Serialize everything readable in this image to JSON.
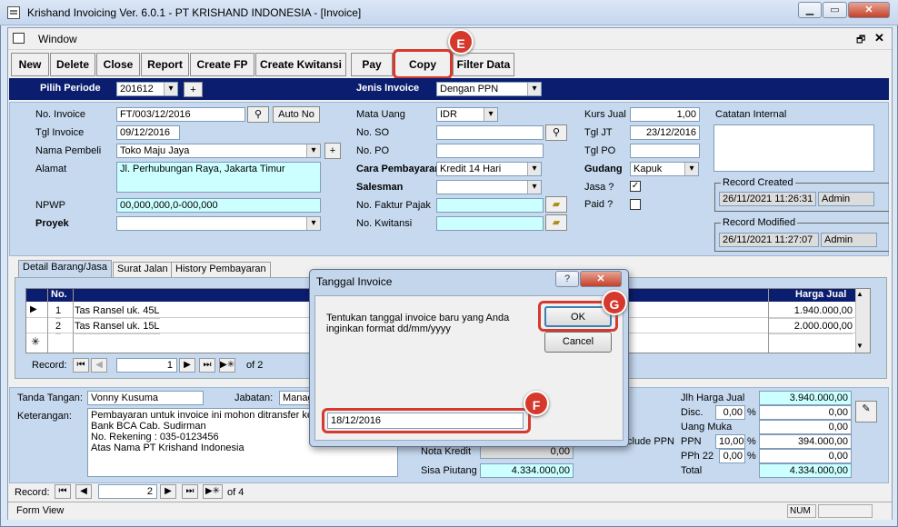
{
  "window": {
    "title": "Krishand Invoicing Ver. 6.0.1 - PT KRISHAND INDONESIA - [Invoice]"
  },
  "menu": {
    "window_label": "Window",
    "restore": "🗗",
    "close": "✕"
  },
  "toolbar": {
    "buttons": [
      "New",
      "Delete",
      "Close",
      "Report",
      "Create FP",
      "Create Kwitansi",
      "Pay",
      "Copy",
      "Filter Data"
    ]
  },
  "badges": {
    "e": "E",
    "f": "F",
    "g": "G"
  },
  "period": {
    "label": "Pilih Periode",
    "value": "201612",
    "plus": "+",
    "jenis_label": "Jenis Invoice",
    "jenis_value": "Dengan PPN"
  },
  "header": {
    "no_invoice_label": "No. Invoice",
    "no_invoice": "FT/003/12/2016",
    "auto_no": "Auto No",
    "tgl_invoice_label": "Tgl Invoice",
    "tgl_invoice": "09/12/2016",
    "nama_pembeli_label": "Nama Pembeli",
    "nama_pembeli": "Toko Maju Jaya",
    "alamat_label": "Alamat",
    "alamat": "Jl. Perhubungan Raya, Jakarta Timur",
    "npwp_label": "NPWP",
    "npwp": "00,000,000,0-000,000",
    "proyek_label": "Proyek",
    "mata_uang_label": "Mata Uang",
    "mata_uang": "IDR",
    "no_so_label": "No. SO",
    "no_po_label": "No. PO",
    "cara_bayar_label": "Cara Pembayaran",
    "cara_bayar": "Kredit 14 Hari",
    "salesman_label": "Salesman",
    "faktur_label": "No. Faktur Pajak",
    "kwitansi_label": "No. Kwitansi",
    "kurs_label": "Kurs Jual",
    "kurs": "1,00",
    "tgl_jt_label": "Tgl JT",
    "tgl_jt": "23/12/2016",
    "tgl_po_label": "Tgl PO",
    "gudang_label": "Gudang",
    "gudang": "Kapuk",
    "jasa_label": "Jasa ?",
    "paid_label": "Paid ?",
    "catatan_label": "Catatan Internal",
    "created_label": "Record Created",
    "created_date": "26/11/2021 11:26:31",
    "created_by": "Admin",
    "modified_label": "Record Modified",
    "modified_date": "26/11/2021 11:27:07",
    "modified_by": "Admin"
  },
  "tabs": [
    "Detail Barang/Jasa",
    "Surat Jalan",
    "History Pembayaran"
  ],
  "grid": {
    "col_no": "No.",
    "col_harga": "Harga Jual",
    "rows": [
      {
        "no": "1",
        "item": "Tas Ransel uk. 45L",
        "harga": "1.940.000,00"
      },
      {
        "no": "2",
        "item": "Tas Ransel uk. 15L",
        "harga": "2.000.000,00"
      }
    ],
    "record_label": "Record:",
    "record_value": "1",
    "record_of": "of  2"
  },
  "footer": {
    "tanda_tangan_label": "Tanda Tangan:",
    "tanda_tangan": "Vonny Kusuma",
    "jabatan_label": "Jabatan:",
    "jabatan": "Manag",
    "keterangan_label": "Keterangan:",
    "keterangan": [
      "Pembayaran untuk invoice ini mohon ditransfer ke r",
      "Bank BCA Cab. Sudirman",
      "No. Rekening : 035-0123456",
      "Atas Nama PT Krishand Indonesia"
    ],
    "nota_kredit_label": "Nota Kredit",
    "nota_kredit": "0,00",
    "sisa_label": "Sisa Piutang",
    "sisa": "4.334.000,00",
    "include_ppn": "clude PPN",
    "jlh_label": "Jlh Harga Jual",
    "jlh": "3.940.000,00",
    "disc_label": "Disc.",
    "disc_pct": "0,00",
    "disc": "0,00",
    "uang_muka_label": "Uang Muka",
    "uang_muka": "0,00",
    "ppn_label": "PPN",
    "ppn_pct": "10,00",
    "ppn": "394.000,00",
    "pph_label": "PPh 22",
    "pph_pct": "0,00",
    "pph": "0,00",
    "total_label": "Total",
    "total": "4.334.000,00",
    "pct": "%"
  },
  "record_nav": {
    "label": "Record:",
    "value": "2",
    "of": "of  4"
  },
  "status": {
    "left": "Form View",
    "num": "NUM"
  },
  "dialog": {
    "title": "Tanggal Invoice",
    "help": "?",
    "close": "✕",
    "message": "Tentukan tanggal invoice baru yang Anda inginkan format dd/mm/yyyy",
    "ok": "OK",
    "cancel": "Cancel",
    "date_value": "18/12/2016"
  }
}
